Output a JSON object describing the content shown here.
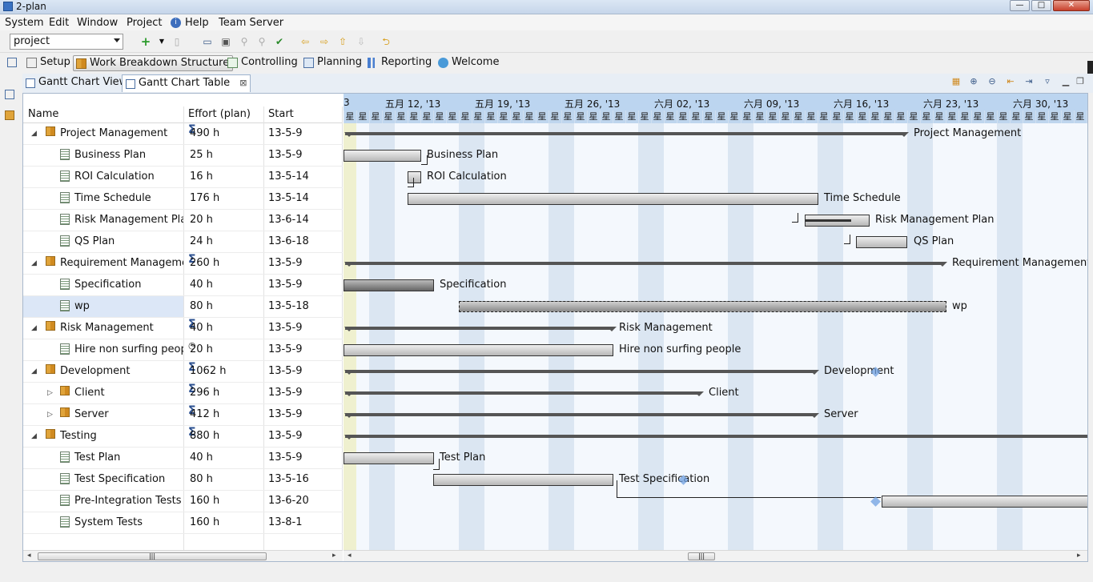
{
  "window": {
    "title": "2-plan",
    "min_label": "—",
    "max_label": "□",
    "close_label": "✕"
  },
  "menu": [
    "System",
    "Edit",
    "Window",
    "Project",
    "Help",
    "Team Server"
  ],
  "toolbar": {
    "project_value": "project"
  },
  "perspectives": [
    "Setup",
    "Work Breakdown Structure",
    "Controlling",
    "Planning",
    "Reporting",
    "Welcome"
  ],
  "tabs": [
    "Gantt Chart View",
    "Gantt Chart Table"
  ],
  "table": {
    "headers": [
      "Name",
      "Effort (plan)",
      "Start"
    ],
    "rows": [
      {
        "name": "Project Management",
        "effort": "490 h",
        "start": "13-5-9"
      },
      {
        "name": "Business Plan",
        "effort": "25 h",
        "start": "13-5-9"
      },
      {
        "name": "ROI Calculation",
        "effort": "16 h",
        "start": "13-5-14"
      },
      {
        "name": "Time Schedule",
        "effort": "176 h",
        "start": "13-5-14"
      },
      {
        "name": "Risk Management Plan",
        "effort": "20 h",
        "start": "13-6-14"
      },
      {
        "name": "QS Plan",
        "effort": "24 h",
        "start": "13-6-18"
      },
      {
        "name": "Requirement Management",
        "effort": "260 h",
        "start": "13-5-9"
      },
      {
        "name": "Specification",
        "effort": "40 h",
        "start": "13-5-9"
      },
      {
        "name": "wp",
        "effort": "80 h",
        "start": "13-5-18"
      },
      {
        "name": "Risk Management",
        "effort": "40 h",
        "start": "13-5-9"
      },
      {
        "name": "Hire non surfing people",
        "effort": "20 h",
        "start": "13-5-9"
      },
      {
        "name": "Development",
        "effort": "1062 h",
        "start": "13-5-9"
      },
      {
        "name": "Client",
        "effort": "296 h",
        "start": "13-5-9"
      },
      {
        "name": "Server",
        "effort": "412 h",
        "start": "13-5-9"
      },
      {
        "name": "Testing",
        "effort": "880 h",
        "start": "13-5-9"
      },
      {
        "name": "Test Plan",
        "effort": "40 h",
        "start": "13-5-9"
      },
      {
        "name": "Test Specification",
        "effort": "80 h",
        "start": "13-5-16"
      },
      {
        "name": "Pre-Integration Tests",
        "effort": "160 h",
        "start": "13-6-20"
      },
      {
        "name": "System Tests",
        "effort": "160 h",
        "start": "13-8-1"
      }
    ]
  },
  "gantt": {
    "first_label": "3",
    "weeks": [
      "五月 12, '13",
      "五月 19, '13",
      "五月 26, '13",
      "六月 02, '13",
      "六月 09, '13",
      "六月 16, '13",
      "六月 23, '13",
      "六月 30, '13"
    ],
    "day_char": "星",
    "bars": [
      "Project Management",
      "Business Plan",
      "ROI Calculation",
      "Time Schedule",
      "Risk Management Plan",
      "QS Plan",
      "Requirement Management",
      "Specification",
      "wp",
      "Risk Management",
      "Hire non surfing people",
      "Development",
      "Client",
      "Server",
      "",
      "Test Plan",
      "Test Specification",
      "",
      ""
    ]
  },
  "colors": {
    "accent": "#bcd5f0",
    "weekend": "#dbe6f2",
    "today": "#eff0cf"
  }
}
